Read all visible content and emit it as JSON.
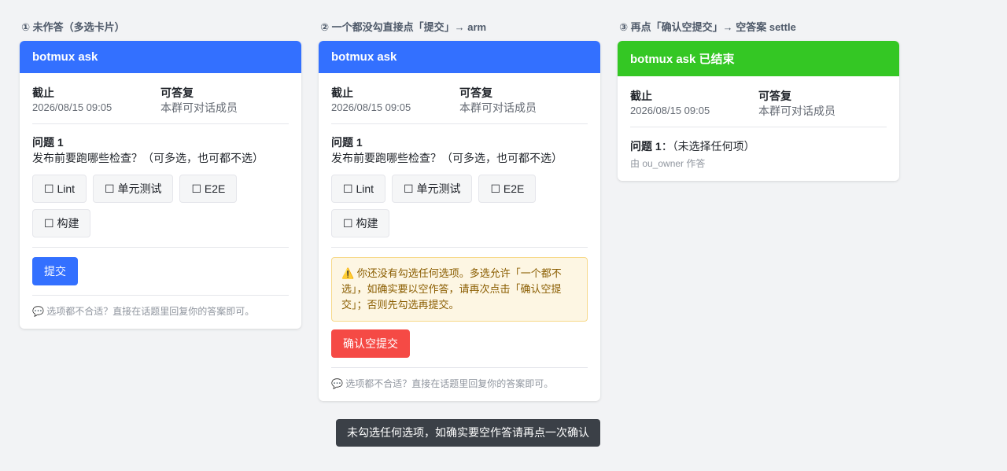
{
  "panels": [
    {
      "step_title": "① 未作答（多选卡片）",
      "header": "botmux ask",
      "deadline_label": "截止",
      "deadline_value": "2026/08/15 09:05",
      "reply_label": "可答复",
      "reply_value": "本群可对话成员",
      "question_title": "问题 1",
      "question_text": "发布前要跑哪些检查？（可多选，也可都不选）",
      "options": [
        "☐ Lint",
        "☐ 单元测试",
        "☐ E2E",
        "☐ 构建"
      ],
      "submit_label": "提交",
      "footer": "💬 选项都不合适？直接在话题里回复你的答案即可。"
    },
    {
      "step_title": "② 一个都没勾直接点「提交」→ arm",
      "header": "botmux ask",
      "deadline_label": "截止",
      "deadline_value": "2026/08/15 09:05",
      "reply_label": "可答复",
      "reply_value": "本群可对话成员",
      "question_title": "问题 1",
      "question_text": "发布前要跑哪些检查？（可多选，也可都不选）",
      "options": [
        "☐ Lint",
        "☐ 单元测试",
        "☐ E2E",
        "☐ 构建"
      ],
      "warning": "⚠️ 你还没有勾选任何选项。多选允许「一个都不选」，如确实要以空作答，请再次点击「确认空提交」；否则先勾选再提交。",
      "confirm_label": "确认空提交",
      "footer": "💬 选项都不合适？直接在话题里回复你的答案即可。"
    },
    {
      "step_title": "③ 再点「确认空提交」→ 空答案 settle",
      "header": "botmux ask 已结束",
      "deadline_label": "截止",
      "deadline_value": "2026/08/15 09:05",
      "reply_label": "可答复",
      "reply_value": "本群可对话成员",
      "answer_title": "问题 1",
      "answer_text": "：（未选择任何项）",
      "answered_by": "由 ou_owner 作答"
    }
  ],
  "toast": "未勾选任何选项，如确实要空作答请再点一次确认",
  "colors": {
    "primary": "#3370ff",
    "success": "#34c724",
    "danger": "#f54a45",
    "warning_bg": "#fdf6e3"
  }
}
